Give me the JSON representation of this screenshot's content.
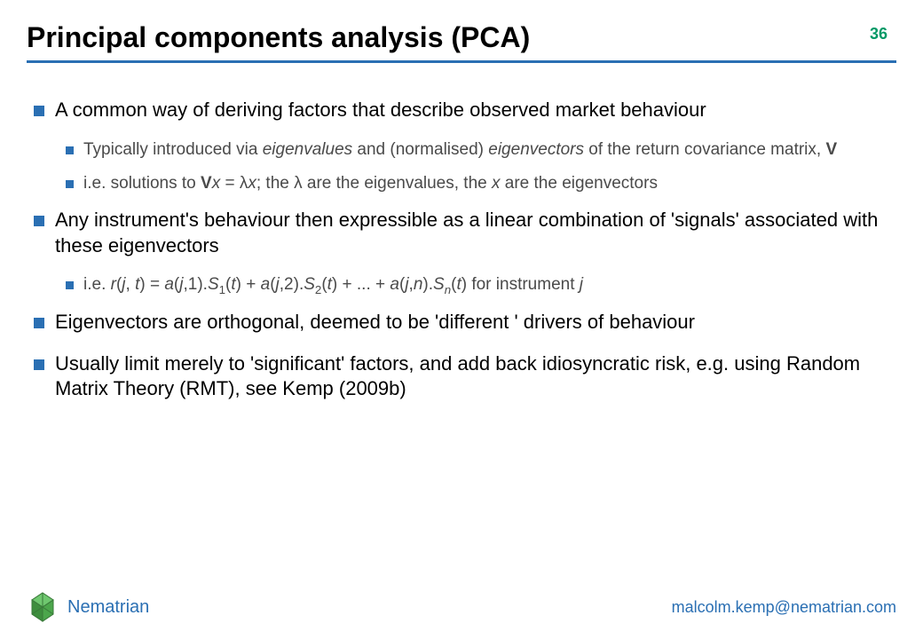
{
  "page_number": "36",
  "title": "Principal components analysis (PCA)",
  "bullets": {
    "b1": "A common way of deriving factors that describe observed market behaviour",
    "b1a_pre": "Typically introduced via ",
    "b1a_eig1": "eigenvalues",
    "b1a_mid": " and (normalised) ",
    "b1a_eig2": "eigenvectors",
    "b1a_post": " of the return covariance matrix, ",
    "b1a_V": "V",
    "b1b_pre": "i.e. solutions to ",
    "b1b_V": "V",
    "b1b_x1": "x",
    "b1b_eq": " = λ",
    "b1b_x2": "x",
    "b1b_mid": "; the λ are the eigenvalues, the ",
    "b1b_x3": "x",
    "b1b_post": " are the eigenvectors",
    "b2": "Any instrument's behaviour then expressible as a linear combination of 'signals' associated with these eigenvectors",
    "b2a_pre": "i.e. ",
    "b2a_r": "r",
    "b2a_p1": "(",
    "b2a_j1": "j",
    "b2a_c1": ", ",
    "b2a_t1": "t",
    "b2a_p2": ") = ",
    "b2a_a1": "a",
    "b2a_p3": "(",
    "b2a_j2": "j",
    "b2a_c2": ",1).",
    "b2a_S1": "S",
    "b2a_sub1": "1",
    "b2a_p4": "(",
    "b2a_t2": "t",
    "b2a_p5": ") + ",
    "b2a_a2": "a",
    "b2a_p6": "(",
    "b2a_j3": "j",
    "b2a_c3": ",2).",
    "b2a_S2": "S",
    "b2a_sub2": "2",
    "b2a_p7": "(",
    "b2a_t3": "t",
    "b2a_p8": ") + ... + ",
    "b2a_a3": "a",
    "b2a_p9": "(",
    "b2a_j4": "j",
    "b2a_c4": ",",
    "b2a_n": "n",
    "b2a_p10": ").",
    "b2a_Sn": "S",
    "b2a_subn": "n",
    "b2a_p11": "(",
    "b2a_t4": "t",
    "b2a_p12": ")   for instrument ",
    "b2a_j5": "j",
    "b3": "Eigenvectors are orthogonal, deemed to be 'different ' drivers of behaviour",
    "b4": "Usually limit merely to 'significant' factors, and add back idiosyncratic risk, e.g. using Random Matrix Theory (RMT), see Kemp (2009b)"
  },
  "brand": "Nematrian",
  "email": "malcolm.kemp@nematrian.com",
  "colors": {
    "accent": "#2a6fb3",
    "page_num": "#009966"
  }
}
